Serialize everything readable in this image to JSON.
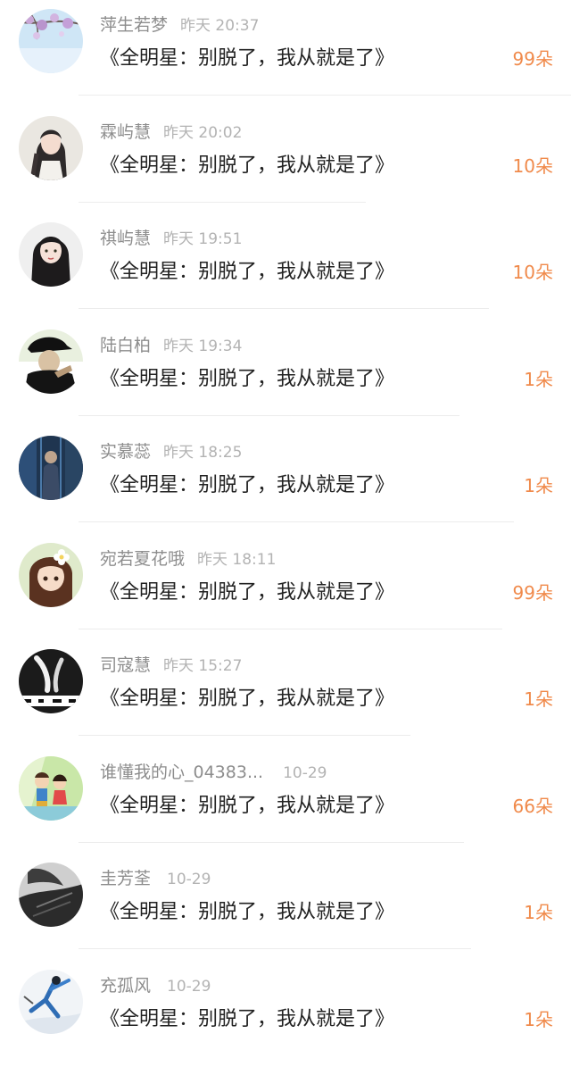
{
  "colors": {
    "username": "#8d8d8d",
    "time": "#b3b3b3",
    "title": "#222222",
    "count": "#f08a4b",
    "divider": "#ececec"
  },
  "items": [
    {
      "username": "萍生若梦",
      "time": "昨天 20:37",
      "title": "《全明星：别脱了，我从就是了》",
      "count": "99朵",
      "avatar": "avatar-cherry-blossom"
    },
    {
      "username": "霖屿慧",
      "time": "昨天 20:02",
      "title": "《全明星：别脱了，我从就是了》",
      "count": "10朵",
      "avatar": "avatar-anime-girl-braid"
    },
    {
      "username": "祺屿慧",
      "time": "昨天 19:51",
      "title": "《全明星：别脱了，我从就是了》",
      "count": "10朵",
      "avatar": "avatar-anime-girl-dark-hair"
    },
    {
      "username": "陆白柏",
      "time": "昨天 19:34",
      "title": "《全明星：别脱了，我从就是了》",
      "count": "1朵",
      "avatar": "avatar-man-cap"
    },
    {
      "username": "实慕蕊",
      "time": "昨天 18:25",
      "title": "《全明星：别脱了，我从就是了》",
      "count": "1朵",
      "avatar": "avatar-blue-figure"
    },
    {
      "username": "宛若夏花哦",
      "time": "昨天 18:11",
      "title": "《全明星：别脱了，我从就是了》",
      "count": "99朵",
      "avatar": "avatar-cartoon-girl-flower"
    },
    {
      "username": "司寇慧",
      "time": "昨天 15:27",
      "title": "《全明星：别脱了，我从就是了》",
      "count": "1朵",
      "avatar": "avatar-monochrome-hands"
    },
    {
      "username": "谁懂我的心_04383...",
      "time": "10-29",
      "title": "《全明星：别脱了，我从就是了》",
      "count": "66朵",
      "avatar": "avatar-cartoon-kids"
    },
    {
      "username": "圭芳荃",
      "time": "10-29",
      "title": "《全明星：别脱了，我从就是了》",
      "count": "1朵",
      "avatar": "avatar-dark-portrait"
    },
    {
      "username": "充孤风",
      "time": "10-29",
      "title": "《全明星：别脱了，我从就是了》",
      "count": "1朵",
      "avatar": "avatar-blue-dancer"
    }
  ]
}
